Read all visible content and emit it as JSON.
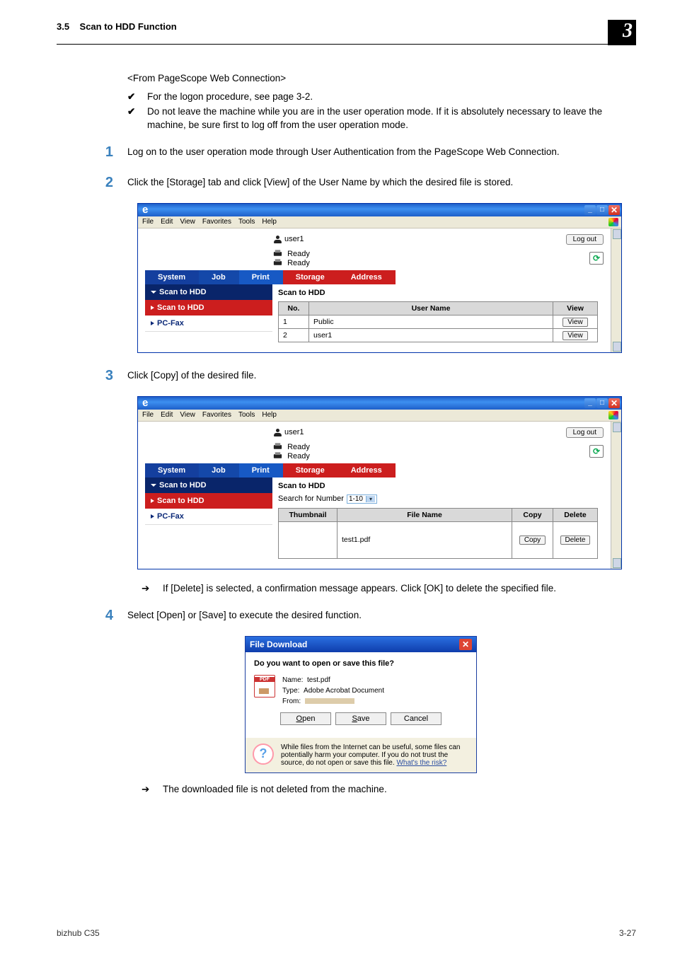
{
  "header": {
    "section_num": "3.5",
    "section_title": "Scan to HDD Function",
    "page_chapter": "3"
  },
  "intro": {
    "from_line": "<From PageScope Web Connection>"
  },
  "bullets": [
    "For the logon procedure, see page 3-2.",
    "Do not leave the machine while you are in the user operation mode. If it is absolutely necessary to leave the machine, be sure first to log off from the user operation mode."
  ],
  "steps": [
    "Log on to the user operation mode through User Authentication from the PageScope Web Connection.",
    "Click the [Storage] tab and click [View] of the User Name by which the desired file is stored.",
    "Click [Copy] of the desired file.",
    "Select [Open] or [Save] to execute the desired function."
  ],
  "arrow_notes": [
    "If [Delete] is selected, a confirmation message appears. Click [OK] to delete the specified file.",
    "The downloaded file is not deleted from the machine."
  ],
  "browser": {
    "menus": [
      "File",
      "Edit",
      "View",
      "Favorites",
      "Tools",
      "Help"
    ],
    "logout": "Log out",
    "username": "user1",
    "ready": "Ready",
    "tabs": {
      "system": "System",
      "job": "Job",
      "print": "Print",
      "storage": "Storage",
      "address": "Address"
    },
    "sidebar": {
      "scan_hdd": "Scan to HDD",
      "scan_hdd_sub": "Scan to HDD",
      "pc_fax": "PC-Fax"
    },
    "panel1": {
      "title": "Scan to HDD",
      "cols": {
        "no": "No.",
        "user": "User Name",
        "view": "View"
      },
      "view_label": "View",
      "rows": [
        {
          "no": "1",
          "user": "Public"
        },
        {
          "no": "2",
          "user": "user1"
        }
      ]
    },
    "panel2": {
      "title": "Scan to HDD",
      "search_label": "Search for Number",
      "search_range": "1-10",
      "cols": {
        "thumb": "Thumbnail",
        "file": "File Name",
        "copy": "Copy",
        "del": "Delete"
      },
      "copy_label": "Copy",
      "delete_label": "Delete",
      "file": "test1.pdf"
    }
  },
  "dialog": {
    "title": "File Download",
    "question": "Do you want to open or save this file?",
    "name_label": "Name:",
    "name": "test.pdf",
    "type_label": "Type:",
    "type": "Adobe Acrobat Document",
    "from_label": "From:",
    "open": "Open",
    "save": "Save",
    "cancel": "Cancel",
    "warning": "While files from the Internet can be useful, some files can potentially harm your computer. If you do not trust the source, do not open or save this file.",
    "risk_link": "What's the risk?"
  },
  "footer": {
    "left": "bizhub C35",
    "right": "3-27"
  }
}
